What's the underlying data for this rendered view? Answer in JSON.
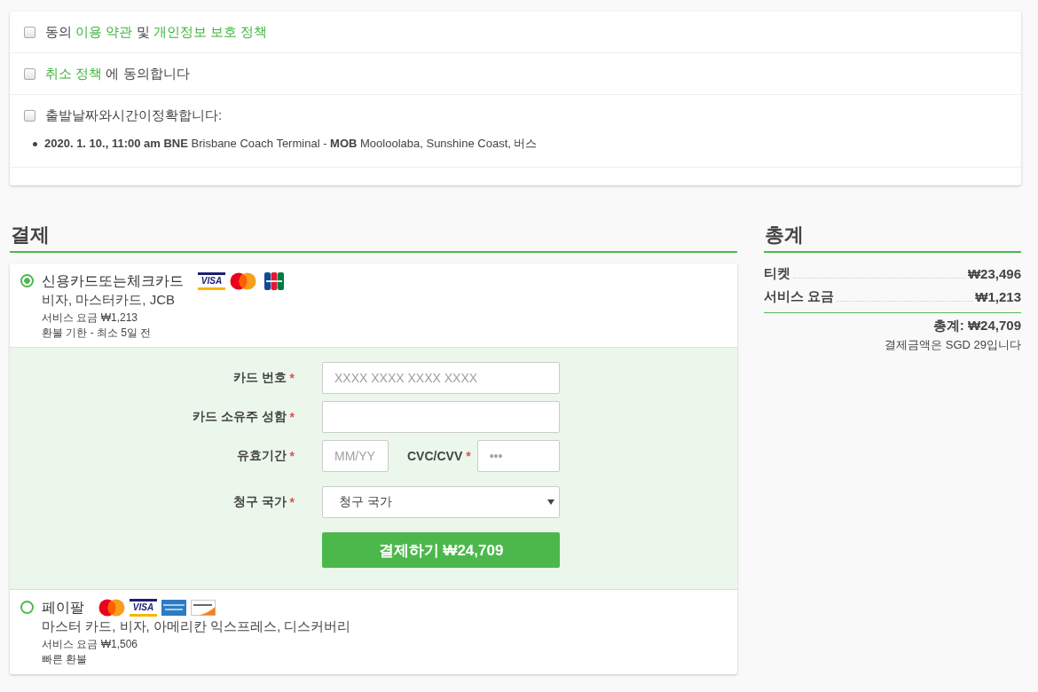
{
  "agreements": [
    {
      "checked": false,
      "segments": [
        {
          "kind": "text",
          "text": "동의 "
        },
        {
          "kind": "link",
          "text": "이용 약관"
        },
        {
          "kind": "text",
          "text": " 및 "
        },
        {
          "kind": "link",
          "text": "개인정보 보호 정책"
        }
      ]
    },
    {
      "checked": false,
      "segments": [
        {
          "kind": "link",
          "text": "취소 정책"
        },
        {
          "kind": "text",
          "text": " 에 동의합니다"
        }
      ]
    },
    {
      "checked": false,
      "segments": [
        {
          "kind": "text",
          "text": "출발날짜와시간이정확합니다:"
        }
      ],
      "trips": [
        "**2020. 1. 10., 11:00 am** **BNE** Brisbane Coach Terminal - **MOB** Mooloolaba, Sunshine Coast, 버스"
      ]
    }
  ],
  "payment": {
    "heading": "결제",
    "methods": [
      {
        "selected": true,
        "title": "신용카드또는체크카드",
        "logos": [
          {
            "kind": "visa",
            "text": "VISA"
          },
          {
            "kind": "mastercard"
          },
          {
            "kind": "jcb"
          }
        ],
        "description": "비자, 마스터카드, JCB",
        "fee": "서비스 요금 ₩1,213",
        "note": "환불 기한 - 최소 5일 전",
        "form": {
          "rows": [
            {
              "label": "카드 번호",
              "required_mark": "*",
              "inputs": [
                {
                  "kind": "text",
                  "placeholder": "XXXX XXXX XXXX XXXX"
                }
              ]
            },
            {
              "label": "카드 소유주 성함",
              "required_mark": "*",
              "inputs": [
                {
                  "kind": "text"
                }
              ]
            },
            {
              "label": "유효기간",
              "required_mark": "*",
              "inputs": [
                {
                  "kind": "short",
                  "placeholder": "MM/YY"
                },
                {
                  "kind": "labeled",
                  "label": "CVC/CVV",
                  "required_mark": "*",
                  "placeholder": "•••"
                }
              ]
            },
            {
              "label": "청구 국가",
              "required_mark": "*",
              "inputs": [
                {
                  "kind": "select",
                  "value": "청구 국가"
                }
              ]
            }
          ],
          "submit": "결제하기 ₩24,709"
        }
      },
      {
        "selected": false,
        "title": "페이팔",
        "logos": [
          {
            "kind": "mastercard"
          },
          {
            "kind": "visa",
            "text": "VISA"
          },
          {
            "kind": "amex"
          },
          {
            "kind": "discover"
          }
        ],
        "description": "마스터 카드, 비자, 아메리칸 익스프레스, 디스커버리",
        "fee": "서비스 요금 ₩1,506",
        "note": "빠른 환불"
      }
    ]
  },
  "summary": {
    "heading": "총계",
    "lines": [
      {
        "label": "티켓",
        "amount": "₩23,496"
      },
      {
        "label": "서비스 요금",
        "amount": "₩1,213"
      }
    ],
    "total": "총계: ₩24,709",
    "note": "결제금액은 SGD 29입니다"
  }
}
